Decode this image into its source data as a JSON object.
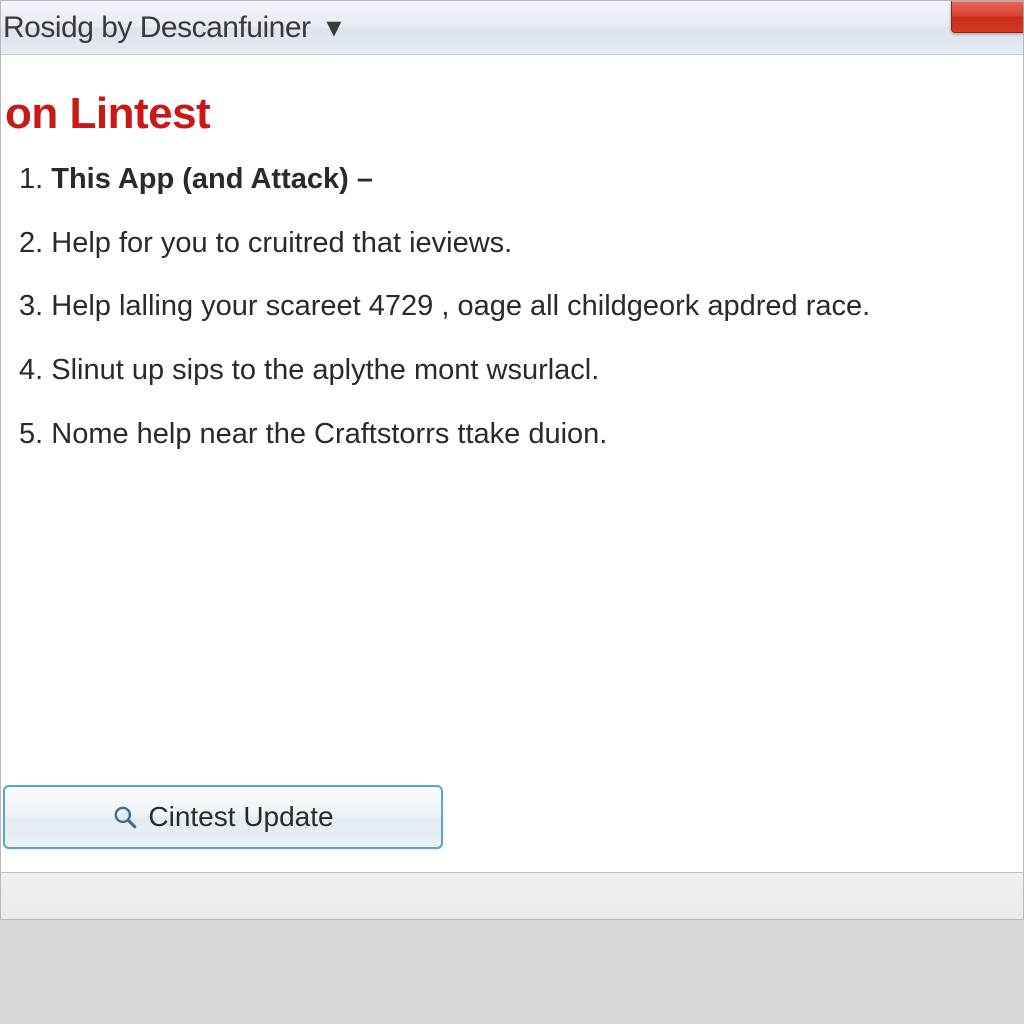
{
  "titlebar": {
    "title": "Rosidg by Descanfuiner",
    "dropdown_glyph": "▾"
  },
  "content": {
    "heading": "on Lintest",
    "items": [
      {
        "num": "1.",
        "text": "This App (and Attack) –",
        "bold": true
      },
      {
        "num": "2.",
        "text": "Help for you to cruitred that ieviews.",
        "bold": false
      },
      {
        "num": "3.",
        "text": "Help lalling your scareet 4729 , oage all childgeork apdred race.",
        "bold": false
      },
      {
        "num": "4.",
        "text": "Slinut up sips to the aplythe mont wsurlacl.",
        "bold": false
      },
      {
        "num": "5.",
        "text": "Nome help near the Craftstorrs ttake duion.",
        "bold": false
      }
    ]
  },
  "button": {
    "label": "Cintest Update"
  }
}
